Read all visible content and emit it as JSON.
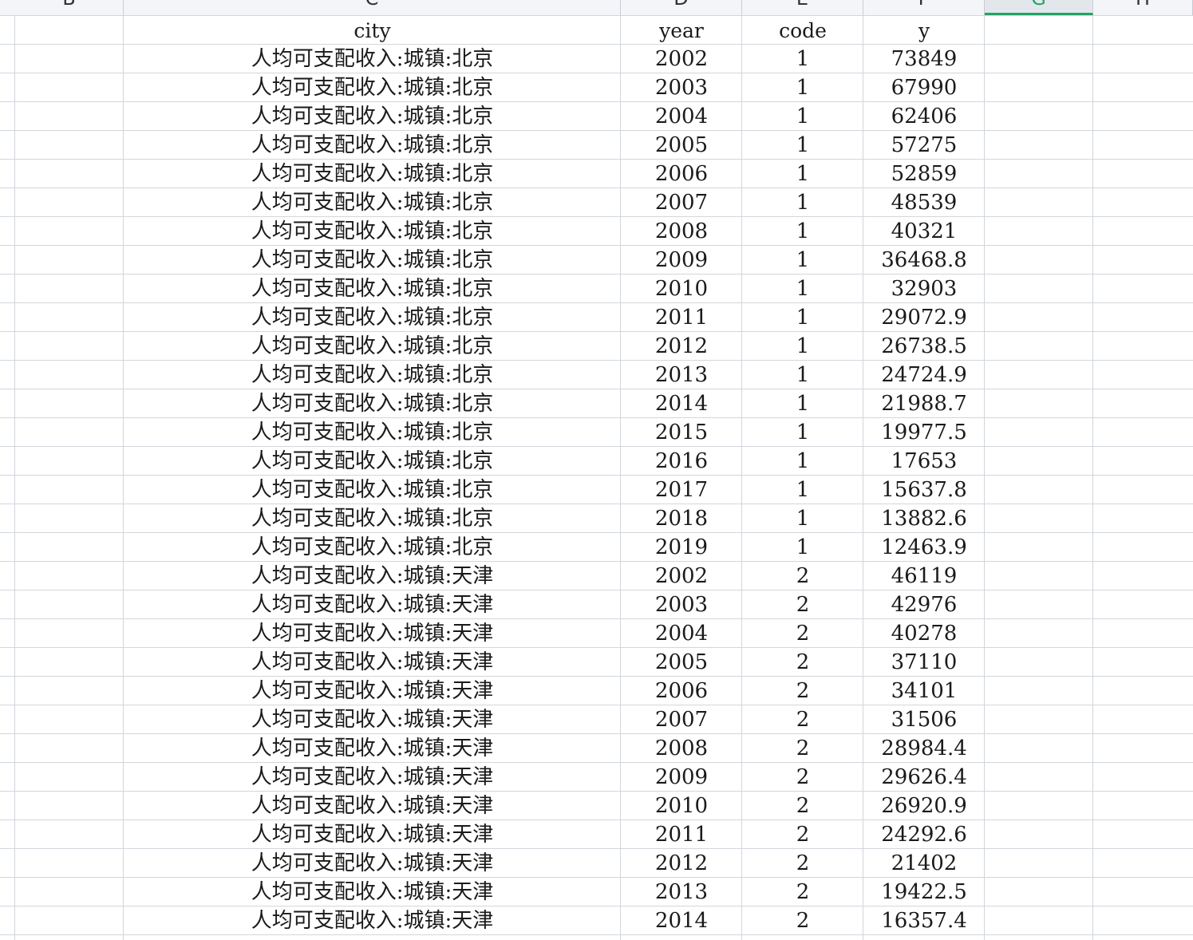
{
  "columns": [
    {
      "letter": "B",
      "id": "b"
    },
    {
      "letter": "C",
      "id": "c"
    },
    {
      "letter": "D",
      "id": "d"
    },
    {
      "letter": "E",
      "id": "e"
    },
    {
      "letter": "F",
      "id": "f"
    },
    {
      "letter": "G",
      "id": "g",
      "selected": true
    },
    {
      "letter": "H",
      "id": "h"
    }
  ],
  "headers": {
    "city": "city",
    "year": "year",
    "code": "code",
    "y": "y"
  },
  "rows": [
    {
      "city": "人均可支配收入:城镇:北京",
      "year": "2002",
      "code": "1",
      "y": "73849"
    },
    {
      "city": "人均可支配收入:城镇:北京",
      "year": "2003",
      "code": "1",
      "y": "67990"
    },
    {
      "city": "人均可支配收入:城镇:北京",
      "year": "2004",
      "code": "1",
      "y": "62406"
    },
    {
      "city": "人均可支配收入:城镇:北京",
      "year": "2005",
      "code": "1",
      "y": "57275"
    },
    {
      "city": "人均可支配收入:城镇:北京",
      "year": "2006",
      "code": "1",
      "y": "52859"
    },
    {
      "city": "人均可支配收入:城镇:北京",
      "year": "2007",
      "code": "1",
      "y": "48539"
    },
    {
      "city": "人均可支配收入:城镇:北京",
      "year": "2008",
      "code": "1",
      "y": "40321"
    },
    {
      "city": "人均可支配收入:城镇:北京",
      "year": "2009",
      "code": "1",
      "y": "36468.8"
    },
    {
      "city": "人均可支配收入:城镇:北京",
      "year": "2010",
      "code": "1",
      "y": "32903"
    },
    {
      "city": "人均可支配收入:城镇:北京",
      "year": "2011",
      "code": "1",
      "y": "29072.9"
    },
    {
      "city": "人均可支配收入:城镇:北京",
      "year": "2012",
      "code": "1",
      "y": "26738.5"
    },
    {
      "city": "人均可支配收入:城镇:北京",
      "year": "2013",
      "code": "1",
      "y": "24724.9"
    },
    {
      "city": "人均可支配收入:城镇:北京",
      "year": "2014",
      "code": "1",
      "y": "21988.7"
    },
    {
      "city": "人均可支配收入:城镇:北京",
      "year": "2015",
      "code": "1",
      "y": "19977.5"
    },
    {
      "city": "人均可支配收入:城镇:北京",
      "year": "2016",
      "code": "1",
      "y": "17653"
    },
    {
      "city": "人均可支配收入:城镇:北京",
      "year": "2017",
      "code": "1",
      "y": "15637.8"
    },
    {
      "city": "人均可支配收入:城镇:北京",
      "year": "2018",
      "code": "1",
      "y": "13882.6"
    },
    {
      "city": "人均可支配收入:城镇:北京",
      "year": "2019",
      "code": "1",
      "y": "12463.9"
    },
    {
      "city": "人均可支配收入:城镇:天津",
      "year": "2002",
      "code": "2",
      "y": "46119"
    },
    {
      "city": "人均可支配收入:城镇:天津",
      "year": "2003",
      "code": "2",
      "y": "42976"
    },
    {
      "city": "人均可支配收入:城镇:天津",
      "year": "2004",
      "code": "2",
      "y": "40278"
    },
    {
      "city": "人均可支配收入:城镇:天津",
      "year": "2005",
      "code": "2",
      "y": "37110"
    },
    {
      "city": "人均可支配收入:城镇:天津",
      "year": "2006",
      "code": "2",
      "y": "34101"
    },
    {
      "city": "人均可支配收入:城镇:天津",
      "year": "2007",
      "code": "2",
      "y": "31506"
    },
    {
      "city": "人均可支配收入:城镇:天津",
      "year": "2008",
      "code": "2",
      "y": "28984.4"
    },
    {
      "city": "人均可支配收入:城镇:天津",
      "year": "2009",
      "code": "2",
      "y": "29626.4"
    },
    {
      "city": "人均可支配收入:城镇:天津",
      "year": "2010",
      "code": "2",
      "y": "26920.9"
    },
    {
      "city": "人均可支配收入:城镇:天津",
      "year": "2011",
      "code": "2",
      "y": "24292.6"
    },
    {
      "city": "人均可支配收入:城镇:天津",
      "year": "2012",
      "code": "2",
      "y": "21402"
    },
    {
      "city": "人均可支配收入:城镇:天津",
      "year": "2013",
      "code": "2",
      "y": "19422.5"
    },
    {
      "city": "人均可支配收入:城镇:天津",
      "year": "2014",
      "code": "2",
      "y": "16357.4"
    }
  ]
}
